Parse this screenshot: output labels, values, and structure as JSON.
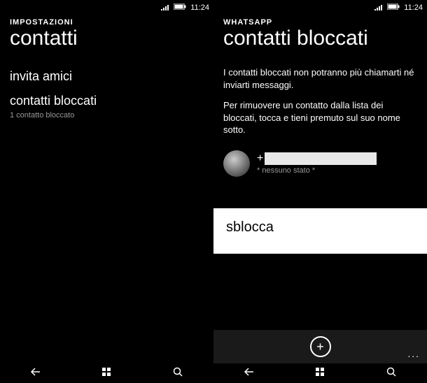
{
  "left": {
    "statusbar": {
      "time": "11:24"
    },
    "header_small": "IMPOSTAZIONI",
    "header_large": "contatti",
    "items": [
      {
        "label": "invita amici",
        "sub": ""
      },
      {
        "label": "contatti bloccati",
        "sub": "1 contatto bloccato"
      }
    ]
  },
  "right": {
    "statusbar": {
      "time": "11:24"
    },
    "header_small": "WHATSAPP",
    "header_large": "contatti bloccati",
    "desc1": "I contatti bloccati non potranno più chiamarti né inviarti messaggi.",
    "desc2": "Per rimuovere un contatto dalla lista dei bloccati, tocca e tieni premuto sul suo nome sotto.",
    "contact": {
      "prefix": "+",
      "status": "* nessuno stato *"
    },
    "context_menu": {
      "unblock": "sblocca"
    },
    "appbar": {
      "add": "+",
      "more": "..."
    }
  }
}
